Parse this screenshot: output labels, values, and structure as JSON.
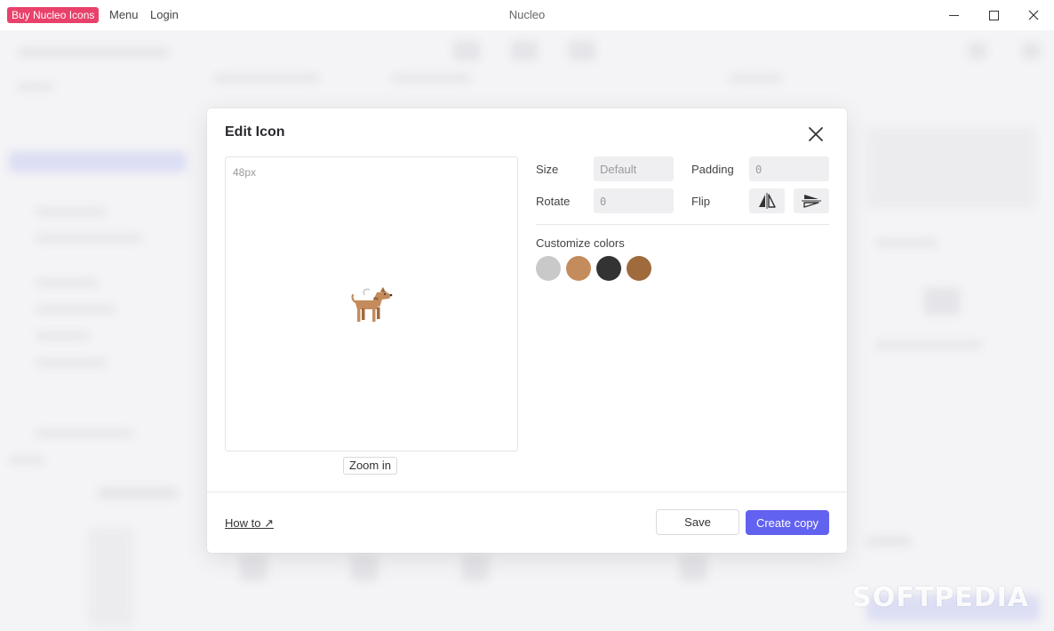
{
  "titlebar": {
    "buy_label": "Buy Nucleo Icons",
    "menu_label": "Menu",
    "login_label": "Login",
    "app_title": "Nucleo",
    "buy_color": "#e8416a"
  },
  "modal": {
    "title": "Edit Icon",
    "preview": {
      "size_label": "48px",
      "icon": "dog-icon",
      "zoom_label": "Zoom in"
    },
    "settings": {
      "size_label": "Size",
      "size_placeholder": "Default",
      "padding_label": "Padding",
      "padding_placeholder": "0",
      "rotate_label": "Rotate",
      "rotate_placeholder": "0",
      "flip_label": "Flip",
      "flip_horizontal_icon": "flip-horizontal-icon",
      "flip_vertical_icon": "flip-vertical-icon"
    },
    "colors": {
      "label": "Customize colors",
      "swatches": [
        "#c9c9c9",
        "#c48c5c",
        "#333333",
        "#9f6a3c"
      ]
    },
    "footer": {
      "howto_label": "How to ↗",
      "save_label": "Save",
      "create_copy_label": "Create copy",
      "accent": "#6262f0"
    }
  },
  "watermark": "SOFTPEDIA"
}
